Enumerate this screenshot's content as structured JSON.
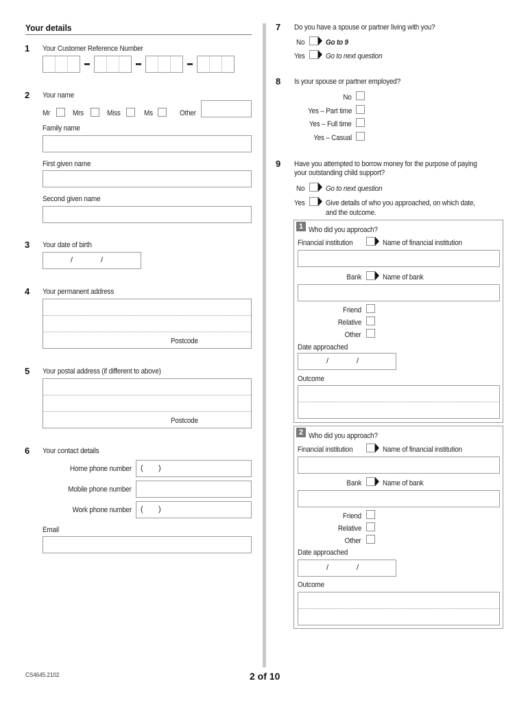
{
  "section": {
    "title": "Your details"
  },
  "q1": {
    "num": "1",
    "label": "Your Customer Reference Number",
    "segments": 4,
    "cells_per_segment": 3
  },
  "q2": {
    "num": "2",
    "label": "Your name",
    "titles": [
      "Mr",
      "Mrs",
      "Miss",
      "Ms"
    ],
    "other_label": "Other",
    "family_name_label": "Family name",
    "first_given_label": "First given name",
    "second_given_label": "Second given name"
  },
  "q3": {
    "num": "3",
    "label": "Your date of birth",
    "date_separator": "/"
  },
  "q4": {
    "num": "4",
    "label": "Your permanent address",
    "postcode_label": "Postcode"
  },
  "q5": {
    "num": "5",
    "label": "Your postal address (if different to above)",
    "postcode_label": "Postcode"
  },
  "q6": {
    "num": "6",
    "label": "Your contact details",
    "home_phone_label": "Home phone number",
    "mobile_phone_label": "Mobile phone number",
    "work_phone_label": "Work phone number",
    "area_code_open": "(",
    "area_code_close": ")",
    "email_label": "Email"
  },
  "q7": {
    "num": "7",
    "label": "Do you have a spouse or partner living with you?",
    "options": [
      {
        "label": "No",
        "instruction": "Go to 9"
      },
      {
        "label": "Yes",
        "instruction": "Go to next question"
      }
    ]
  },
  "q8": {
    "num": "8",
    "label": "Is your spouse or partner employed?",
    "options": [
      "No",
      "Yes – Part time",
      "Yes – Full time",
      "Yes – Casual"
    ]
  },
  "q9": {
    "num": "9",
    "label_line1": "Have you attempted to borrow money for the purpose of paying",
    "label_line2": "your outstanding child support?",
    "no_label": "No",
    "no_instruction": "Go to next question",
    "yes_label": "Yes",
    "yes_instruction_line1": "Give details of who you approached, on which date,",
    "yes_instruction_line2": "and the outcome.",
    "approaches": [
      {
        "badge": "1",
        "heading": "Who did you approach?",
        "financial_label": "Financial institution",
        "financial_name_label": "Name of financial institution",
        "bank_label": "Bank",
        "bank_name_label": "Name of bank",
        "other_options": [
          "Friend",
          "Relative",
          "Other"
        ],
        "date_label": "Date approached",
        "outcome_label": "Outcome"
      },
      {
        "badge": "2",
        "heading": "Who did you approach?",
        "financial_label": "Financial institution",
        "financial_name_label": "Name of financial institution",
        "bank_label": "Bank",
        "bank_name_label": "Name of bank",
        "other_options": [
          "Friend",
          "Relative",
          "Other"
        ],
        "date_label": "Date approached",
        "outcome_label": "Outcome"
      }
    ]
  },
  "footer": {
    "form_code": "CS4645.2102",
    "page_indicator": "2 of 10"
  }
}
